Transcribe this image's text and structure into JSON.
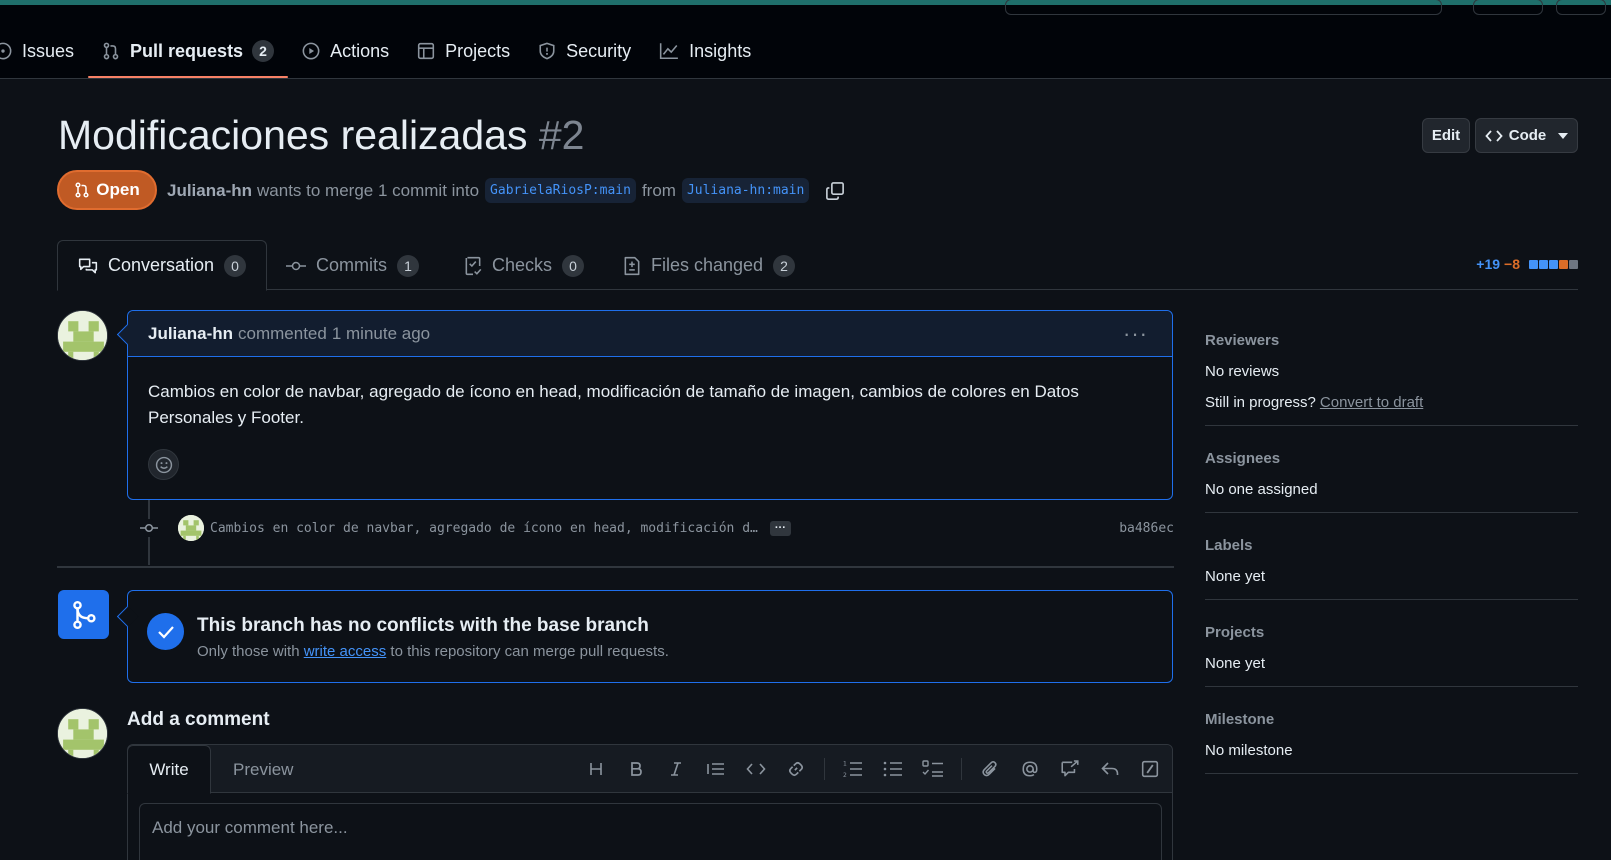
{
  "repo_nav": {
    "items": [
      {
        "label": "Issues",
        "icon": "issue-opened-icon"
      },
      {
        "label": "Pull requests",
        "icon": "git-pull-request-icon",
        "count": "2",
        "active": true
      },
      {
        "label": "Actions",
        "icon": "play-icon"
      },
      {
        "label": "Projects",
        "icon": "table-icon"
      },
      {
        "label": "Security",
        "icon": "shield-icon"
      },
      {
        "label": "Insights",
        "icon": "graph-icon"
      }
    ]
  },
  "pr": {
    "title": "Modificaciones realizadas",
    "number": "#2",
    "state": "Open",
    "author": "Juliana-hn",
    "merge_text_1": "wants to merge 1 commit into",
    "base_branch": "GabrielaRiosP:main",
    "merge_text_2": "from",
    "head_branch": "Juliana-hn:main"
  },
  "header_actions": {
    "edit": "Edit",
    "code": "Code"
  },
  "tabs": [
    {
      "label": "Conversation",
      "count": "0",
      "icon": "comment-discussion-icon"
    },
    {
      "label": "Commits",
      "count": "1",
      "icon": "git-commit-icon"
    },
    {
      "label": "Checks",
      "count": "0",
      "icon": "checklist-icon"
    },
    {
      "label": "Files changed",
      "count": "2",
      "icon": "file-diff-icon"
    }
  ],
  "diffstat": {
    "additions": "+19",
    "deletions": "−8",
    "colors": {
      "add": "#4493f8",
      "del": "#db6d28",
      "neutral": "#6e7681"
    }
  },
  "comment": {
    "author": "Juliana-hn",
    "action": "commented",
    "time": "1 minute ago",
    "body": "Cambios en color de navbar, agregado de ícono en head, modificación de tamaño de imagen, cambios de colores en Datos Personales y Footer."
  },
  "commit": {
    "message": "Cambios en color de navbar, agregado de ícono en head, modificación d…",
    "more": "···",
    "sha": "ba486ec"
  },
  "merge_status": {
    "title": "This branch has no conflicts with the base branch",
    "sub_before": "Only those with",
    "sub_link": "write access",
    "sub_after": "to this repository can merge pull requests."
  },
  "add_comment": {
    "title": "Add a comment",
    "write_tab": "Write",
    "preview_tab": "Preview",
    "placeholder": "Add your comment here..."
  },
  "sidebar": {
    "reviewers": {
      "title": "Reviewers",
      "value": "No reviews",
      "progress_q": "Still in progress?",
      "draft_link": "Convert to draft"
    },
    "assignees": {
      "title": "Assignees",
      "value": "No one assigned"
    },
    "labels": {
      "title": "Labels",
      "value": "None yet"
    },
    "projects": {
      "title": "Projects",
      "value": "None yet"
    },
    "milestone": {
      "title": "Milestone",
      "value": "No milestone"
    }
  },
  "colors": {
    "accent": "#1f6feb",
    "open_state": "#c05a24",
    "background": "#0d1117",
    "tab_underline": "#f78166"
  }
}
